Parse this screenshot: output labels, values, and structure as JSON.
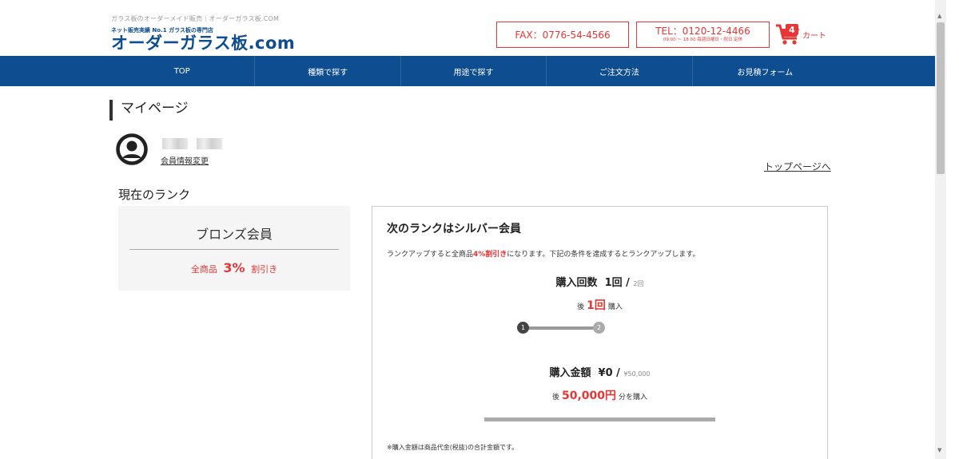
{
  "header": {
    "tagline": "ガラス板のオーダーメイド販売｜オーダーガラス板.COM",
    "logo_sub": "ネット販売実績 No.1 ガラス板の専門店",
    "logo_main": "オーダーガラス板.com",
    "fax": "FAX：0776-54-4566",
    "tel": "TEL：0120-12-4466",
    "tel_hours": "09:00 ～ 18:00 毎週日曜日・祝日 定休",
    "cart_count": "4",
    "cart_label": "カート"
  },
  "nav": {
    "items": [
      {
        "label": "TOP"
      },
      {
        "label": "種類で探す"
      },
      {
        "label": "用途で探す"
      },
      {
        "label": "ご注文方法"
      },
      {
        "label": "お見積フォーム"
      }
    ]
  },
  "page": {
    "title": "マイページ",
    "member_edit": "会員情報変更",
    "top_link": "トップページへ",
    "rank_heading": "現在のランク"
  },
  "current_rank": {
    "name": "ブロンズ会員",
    "prefix": "全商品",
    "discount": "3%",
    "suffix": "割引き"
  },
  "next_rank": {
    "title": "次のランクはシルバー会員",
    "desc_pre": "ランクアップすると全商品",
    "desc_highlight": "4%割引き",
    "desc_post": "になります。下記の条件を達成するとランクアップします。",
    "count_label": "購入回数",
    "count_value": "1回",
    "count_sep": "/",
    "count_target": "2回",
    "count_remain_pre": "後",
    "count_remain_value": "1回",
    "count_remain_post": "購入",
    "step1": "1",
    "step2": "2",
    "count_progress": 0.5,
    "amount_label": "購入金額",
    "amount_value": "¥0",
    "amount_sep": "/",
    "amount_target": "¥50,000",
    "amount_remain_pre": "後",
    "amount_remain_value": "50,000円",
    "amount_remain_post": "分を購入",
    "amount_progress": 0,
    "footnote": "※購入金額は商品代金(税抜)の合計金額です。"
  },
  "colors": {
    "brand_blue": "#0e4d8f",
    "accent_red": "#e63636"
  }
}
